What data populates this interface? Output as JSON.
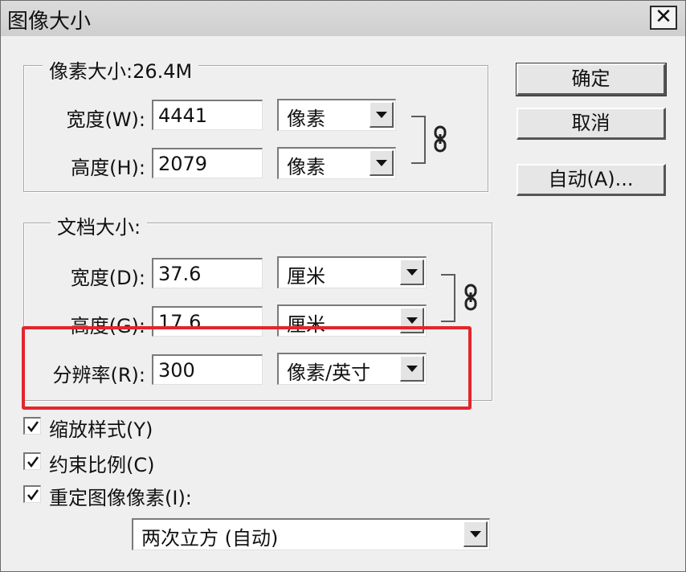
{
  "window": {
    "title": "图像大小",
    "close_symbol": "✕"
  },
  "pixel_dimensions": {
    "legend": "像素大小:26.4M",
    "width": {
      "label": "宽度(W):",
      "value": "4441",
      "unit": "像素"
    },
    "height": {
      "label": "高度(H):",
      "value": "2079",
      "unit": "像素"
    }
  },
  "document_size": {
    "legend": "文档大小:",
    "width": {
      "label": "宽度(D):",
      "value": "37.6",
      "unit": "厘米"
    },
    "height": {
      "label": "高度(G):",
      "value": "17.6",
      "unit": "厘米"
    },
    "resolution": {
      "label": "分辨率(R):",
      "value": "300",
      "unit": "像素/英寸"
    }
  },
  "buttons": {
    "ok": "确定",
    "cancel": "取消",
    "auto": "自动(A)..."
  },
  "options": {
    "scale_styles": {
      "label": "缩放样式(Y)",
      "checked": true
    },
    "constrain_proportions": {
      "label": "约束比例(C)",
      "checked": true
    },
    "resample_image": {
      "label": "重定图像像素(I):",
      "checked": true
    }
  },
  "resample_method": "两次立方 (自动)",
  "colors": {
    "highlight_box": "#e2262b"
  }
}
